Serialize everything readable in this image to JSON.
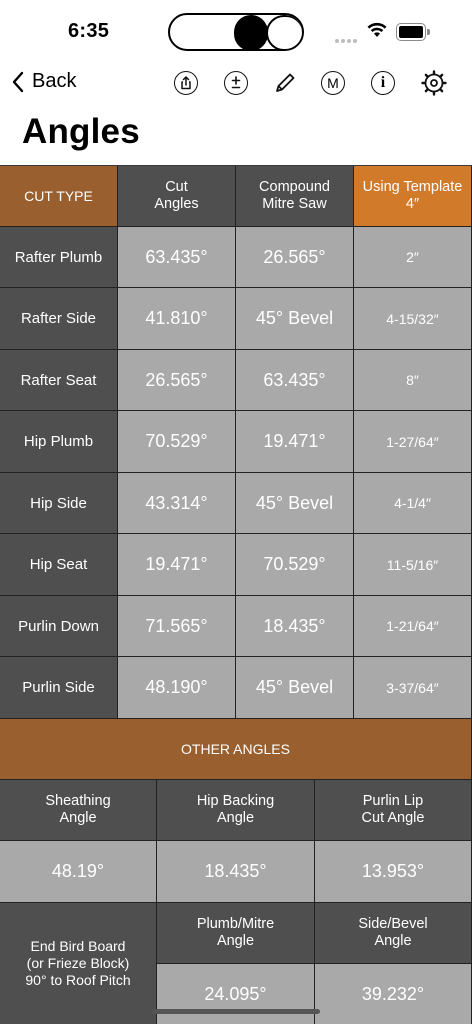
{
  "status": {
    "time": "6:35"
  },
  "nav": {
    "back_label": "Back"
  },
  "title": "Angles",
  "colors": {
    "dark_cell": "#4f4f4f",
    "light_cell": "#a9a9a9",
    "brown": "#9a5f2f",
    "orange": "#d17a2a"
  },
  "angles_table": {
    "headers": [
      "CUT TYPE",
      "Cut\nAngles",
      "Compound\nMitre Saw",
      "Using Template\n4″"
    ],
    "rows": [
      {
        "label": "Rafter Plumb",
        "cut": "63.435°",
        "mitre": "26.565°",
        "template": "2″"
      },
      {
        "label": "Rafter Side",
        "cut": "41.810°",
        "mitre": "45° Bevel",
        "template": "4-15/32″"
      },
      {
        "label": "Rafter Seat",
        "cut": "26.565°",
        "mitre": "63.435°",
        "template": "8″"
      },
      {
        "label": "Hip Plumb",
        "cut": "70.529°",
        "mitre": "19.471°",
        "template": "1-27/64″"
      },
      {
        "label": "Hip Side",
        "cut": "43.314°",
        "mitre": "45° Bevel",
        "template": "4-1/4″"
      },
      {
        "label": "Hip Seat",
        "cut": "19.471°",
        "mitre": "70.529°",
        "template": "11-5/16″"
      },
      {
        "label": "Purlin Down",
        "cut": "71.565°",
        "mitre": "18.435°",
        "template": "1-21/64″"
      },
      {
        "label": "Purlin Side",
        "cut": "48.190°",
        "mitre": "45° Bevel",
        "template": "3-37/64″"
      }
    ]
  },
  "other_angles": {
    "title": "OTHER ANGLES",
    "headers": [
      "Sheathing\nAngle",
      "Hip Backing\nAngle",
      "Purlin Lip\nCut Angle"
    ],
    "values": [
      "48.19°",
      "18.435°",
      "13.953°"
    ],
    "bird_label": "End Bird Board\n(or Frieze Block)\n90° to Roof Pitch",
    "bird_headers": [
      "Plumb/Mitre\nAngle",
      "Side/Bevel\nAngle"
    ],
    "bird_values": [
      "24.095°",
      "39.232°"
    ]
  }
}
